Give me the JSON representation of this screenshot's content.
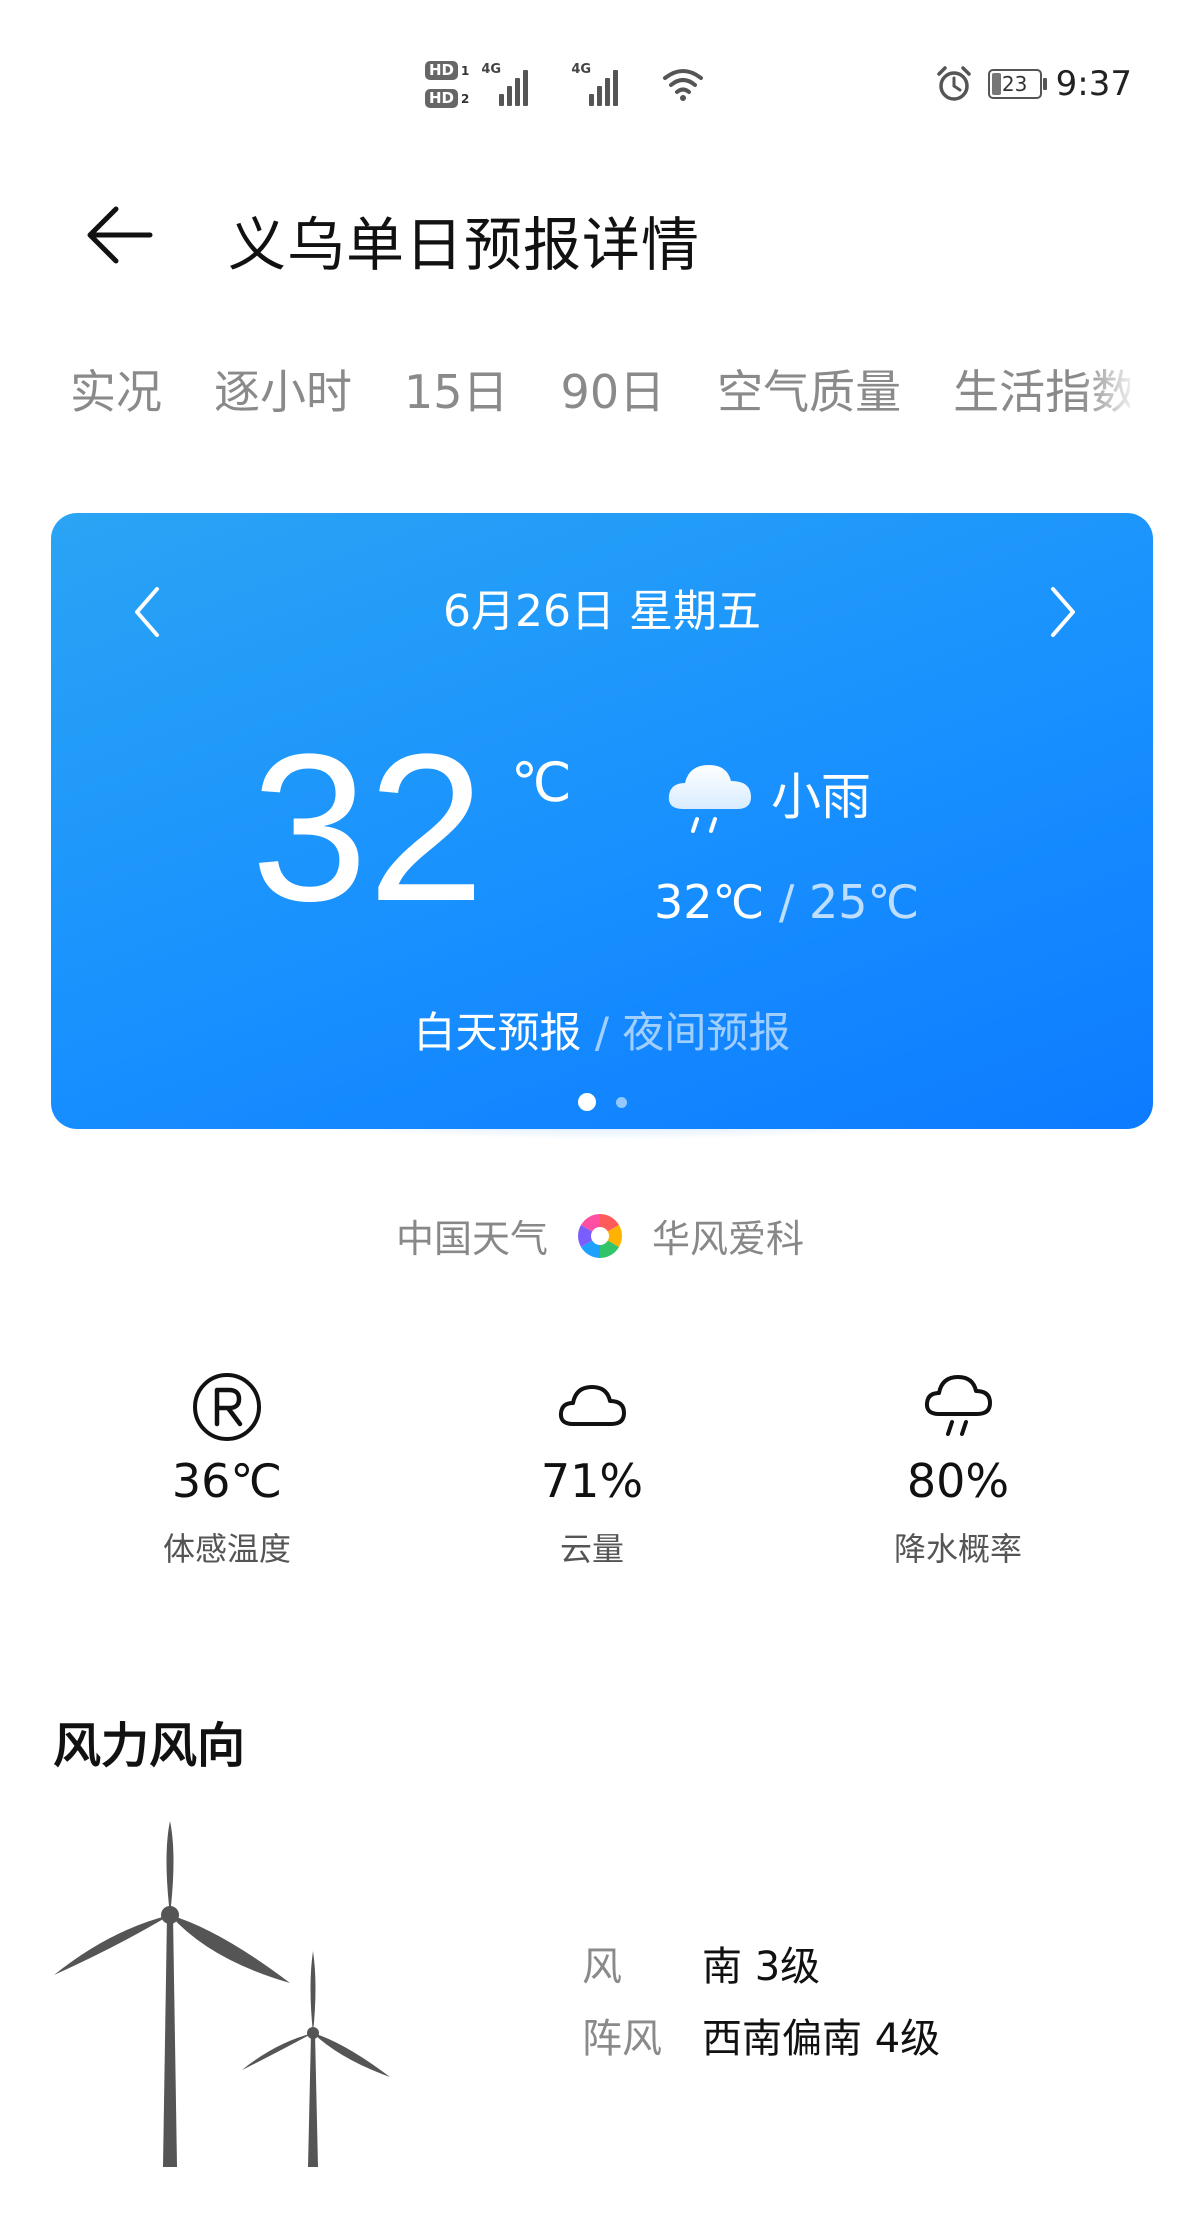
{
  "status_bar": {
    "hd1": "HD",
    "hd1_n": "1",
    "hd2": "HD",
    "hd2_n": "2",
    "net1": "4G",
    "net2": "4G",
    "battery": "23",
    "time": "9:37"
  },
  "header": {
    "title": "义乌单日预报详情"
  },
  "tabs": [
    {
      "label": "实况"
    },
    {
      "label": "逐小时"
    },
    {
      "label": "15日"
    },
    {
      "label": "90日"
    },
    {
      "label": "空气质量"
    },
    {
      "label": "生活指数"
    }
  ],
  "card": {
    "date": "6月26日 星期五",
    "temperature": "32",
    "unit": "℃",
    "condition": "小雨",
    "condition_icon": "light-rain-icon",
    "high": "32℃",
    "sep": " / ",
    "low": "25℃",
    "day_label": "白天预报",
    "mode_sep": " / ",
    "night_label": "夜间预报",
    "page_count": 2,
    "active_page": 1,
    "colors": {
      "gradient_start": "#2aa4f4",
      "gradient_end": "#0d7bff"
    }
  },
  "source": {
    "left": "中国天气",
    "right": "华风爱科",
    "logo_icon": "color-pinwheel-icon"
  },
  "metrics": [
    {
      "value": "36℃",
      "label": "体感温度",
      "icon": "registered-r-icon"
    },
    {
      "value": "71%",
      "label": "云量",
      "icon": "cloud-icon"
    },
    {
      "value": "80%",
      "label": "降水概率",
      "icon": "rain-cloud-icon"
    }
  ],
  "wind": {
    "heading": "风力风向",
    "rows": [
      {
        "key": "风",
        "value": "南 3级"
      },
      {
        "key": "阵风",
        "value": "西南偏南 4级"
      }
    ]
  }
}
